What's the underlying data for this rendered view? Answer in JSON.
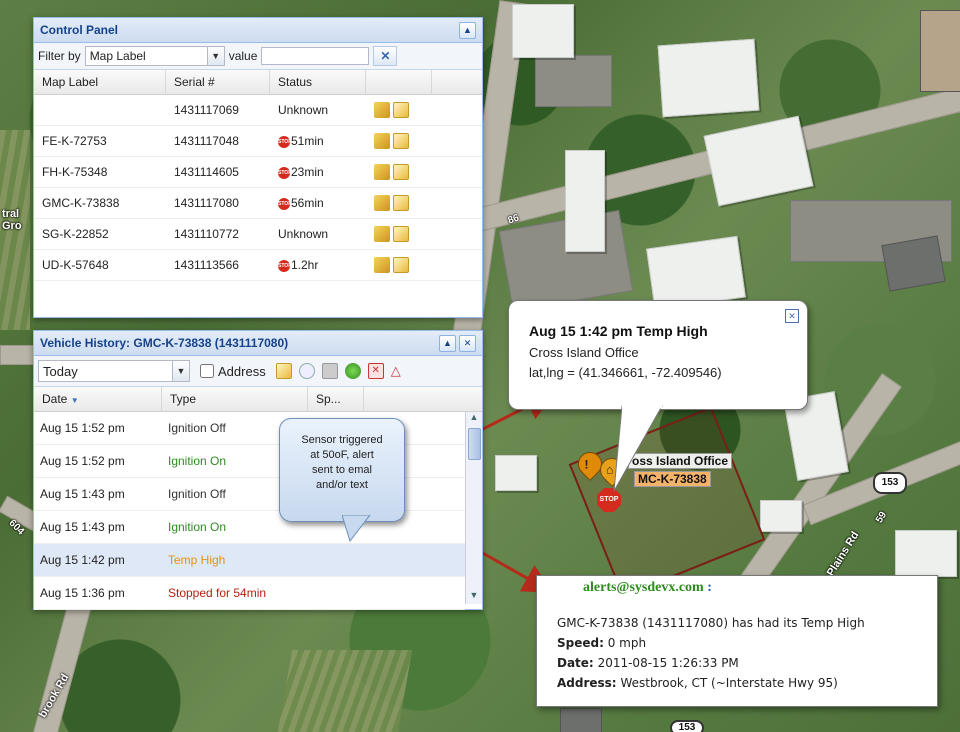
{
  "map": {
    "left_label_lines": [
      "tral",
      "Gro"
    ],
    "road_label_86": "86",
    "hwy_153_a": "153",
    "hwy_153_bottom": "153",
    "road_label_604": "604",
    "road_plains": "Plains Rd",
    "road_label_59": "59",
    "road_brook": "brook Rd",
    "location_name": "Cross Island Office",
    "location_label_visible": "oss Island Office",
    "vehicle_label": "GMC-K-73838",
    "vehicle_label_visible": "MC-K-73838",
    "stop_text": "STOP"
  },
  "control_panel": {
    "title": "Control Panel",
    "filter_label": "Filter by",
    "filter_value": "Map Label",
    "value_label": "value",
    "value_input": "",
    "clear_glyph": "✕",
    "collapse_glyph": "▲",
    "columns": [
      "Map Label",
      "Serial #",
      "Status"
    ],
    "rows": [
      {
        "label": "",
        "serial": "1431117069",
        "status": "Unknown",
        "stop": false
      },
      {
        "label": "FE-K-72753",
        "serial": "1431117048",
        "status": "51min",
        "stop": true
      },
      {
        "label": "FH-K-75348",
        "serial": "1431114605",
        "status": "23min",
        "stop": true
      },
      {
        "label": "GMC-K-73838",
        "serial": "1431117080",
        "status": "56min",
        "stop": true
      },
      {
        "label": "SG-K-22852",
        "serial": "1431110772",
        "status": "Unknown",
        "stop": false
      },
      {
        "label": "UD-K-57648",
        "serial": "1431113566",
        "status": "1.2hr",
        "stop": true
      }
    ]
  },
  "history_panel": {
    "title": "Vehicle History: GMC-K-73838 (1431117080)",
    "range_value": "Today",
    "address_label": "Address",
    "columns": [
      "Date",
      "Type",
      "Sp..."
    ],
    "sort_glyph": "▼",
    "rows": [
      {
        "date": "Aug 15 1:52 pm",
        "type": "Ignition Off",
        "color": "#333333"
      },
      {
        "date": "Aug 15 1:52 pm",
        "type": "Ignition On",
        "color": "#2e8b1f"
      },
      {
        "date": "Aug 15 1:43 pm",
        "type": "Ignition Off",
        "color": "#333333"
      },
      {
        "date": "Aug 15 1:43 pm",
        "type": "Ignition On",
        "color": "#2e8b1f"
      },
      {
        "date": "Aug 15 1:42 pm",
        "type": "Temp High",
        "color": "#e8900a"
      },
      {
        "date": "Aug 15 1:36 pm",
        "type": "Stopped for 54min",
        "color": "#b8200f"
      }
    ]
  },
  "note": {
    "lines": [
      "Sensor triggered",
      "at 50oF, alert",
      "sent to emal",
      "and/or text"
    ]
  },
  "map_popup": {
    "title": "Aug 15 1:42 pm Temp High",
    "location": "Cross Island Office",
    "coords": "lat,lng = (41.346661, -72.409546)",
    "close_glyph": "✕"
  },
  "email": {
    "from": "alerts@sysdevx.com",
    "from_suffix": ":",
    "body": "GMC-K-73838 (1431117080) has had its Temp High",
    "speed_label": "Speed:",
    "speed_value": "0 mph",
    "date_label": "Date:",
    "date_value": "2011-08-15 1:26:33 PM",
    "address_label": "Address:",
    "address_value": "Westbrook, CT (~Interstate Hwy 95)"
  },
  "colors": {
    "panel_title": "#15428b",
    "email_from": "#2e8b1f",
    "arrow": "#b52a1a"
  }
}
